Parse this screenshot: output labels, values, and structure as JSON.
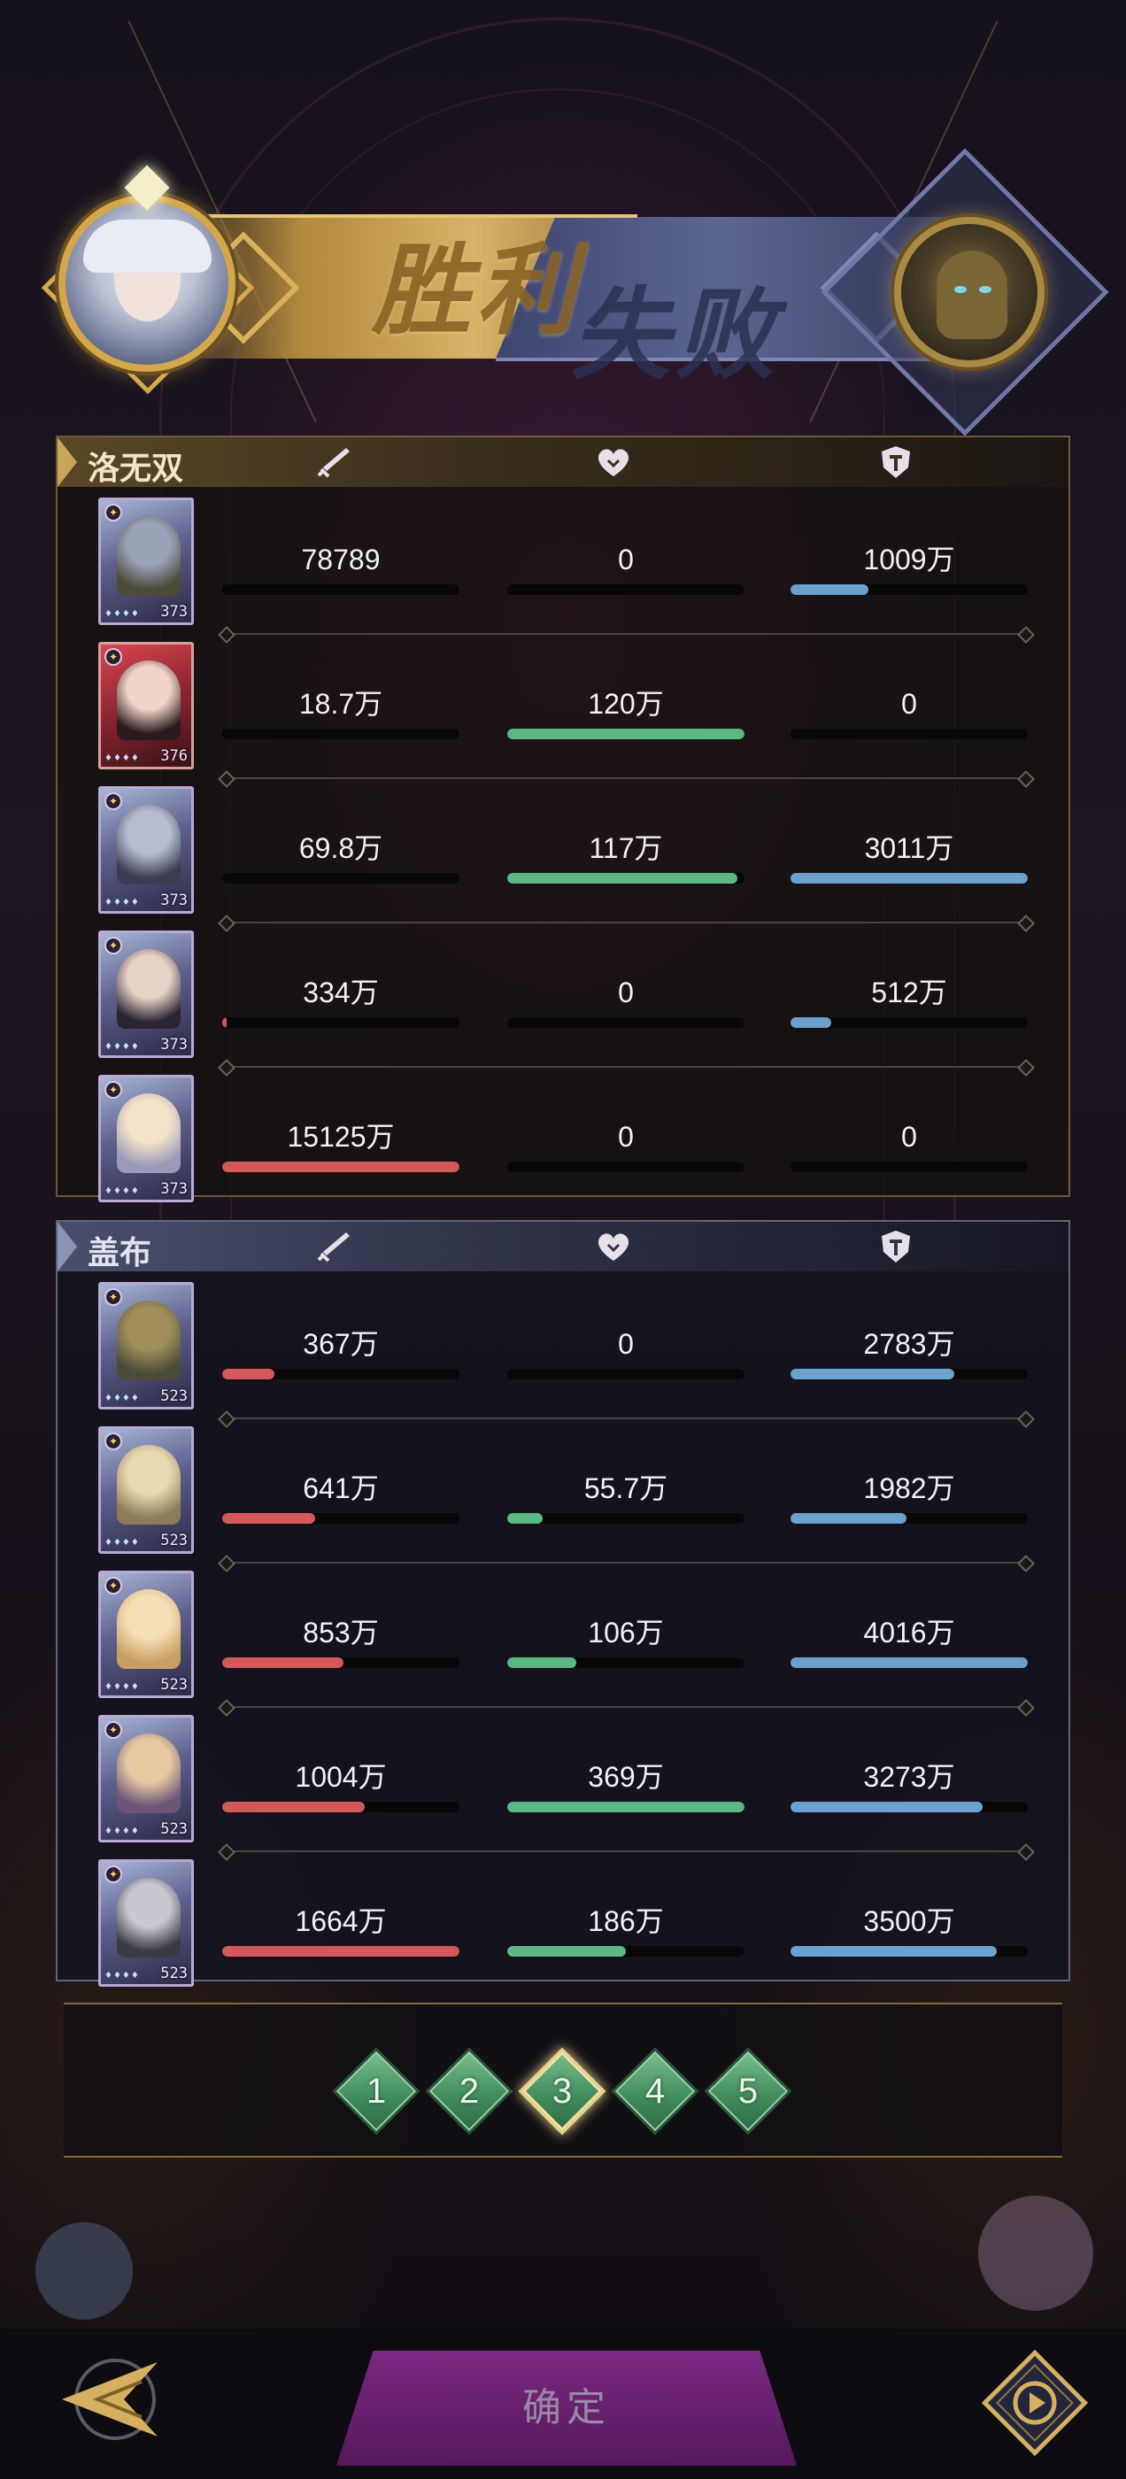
{
  "banner": {
    "win_text": "胜利",
    "lose_text": "失败"
  },
  "icons": {
    "damage": "sword-icon",
    "heal": "heart-icon",
    "shield": "shield-icon"
  },
  "teams": [
    {
      "name": "洛无双",
      "rows": [
        {
          "card_level": "373",
          "damage": "78789",
          "damage_ratio": 0,
          "heal": "0",
          "heal_ratio": 0,
          "shield": "1009万",
          "shield_ratio": 0.33
        },
        {
          "card_level": "376",
          "damage": "18.7万",
          "damage_ratio": 0,
          "heal": "120万",
          "heal_ratio": 1.0,
          "shield": "0",
          "shield_ratio": 0
        },
        {
          "card_level": "373",
          "damage": "69.8万",
          "damage_ratio": 0,
          "heal": "117万",
          "heal_ratio": 0.97,
          "shield": "3011万",
          "shield_ratio": 1.0
        },
        {
          "card_level": "373",
          "damage": "334万",
          "damage_ratio": 0.02,
          "heal": "0",
          "heal_ratio": 0,
          "shield": "512万",
          "shield_ratio": 0.17
        },
        {
          "card_level": "373",
          "damage": "15125万",
          "damage_ratio": 1.0,
          "heal": "0",
          "heal_ratio": 0,
          "shield": "0",
          "shield_ratio": 0
        }
      ]
    },
    {
      "name": "盖布",
      "rows": [
        {
          "card_level": "523",
          "damage": "367万",
          "damage_ratio": 0.22,
          "heal": "0",
          "heal_ratio": 0,
          "shield": "2783万",
          "shield_ratio": 0.69
        },
        {
          "card_level": "523",
          "damage": "641万",
          "damage_ratio": 0.39,
          "heal": "55.7万",
          "heal_ratio": 0.15,
          "shield": "1982万",
          "shield_ratio": 0.49
        },
        {
          "card_level": "523",
          "damage": "853万",
          "damage_ratio": 0.51,
          "heal": "106万",
          "heal_ratio": 0.29,
          "shield": "4016万",
          "shield_ratio": 1.0
        },
        {
          "card_level": "523",
          "damage": "1004万",
          "damage_ratio": 0.6,
          "heal": "369万",
          "heal_ratio": 1.0,
          "shield": "3273万",
          "shield_ratio": 0.81
        },
        {
          "card_level": "523",
          "damage": "1664万",
          "damage_ratio": 1.0,
          "heal": "186万",
          "heal_ratio": 0.5,
          "shield": "3500万",
          "shield_ratio": 0.87
        }
      ]
    }
  ],
  "pagination": {
    "pages": [
      "1",
      "2",
      "3",
      "4",
      "5"
    ],
    "active_index": 2
  },
  "bottom": {
    "confirm_label": "确定"
  },
  "colors": {
    "damage": "#d4585a",
    "heal": "#5bb882",
    "shield": "#6aa1cd",
    "gold": "#d4a84a",
    "page_green": "#4f9c69"
  }
}
